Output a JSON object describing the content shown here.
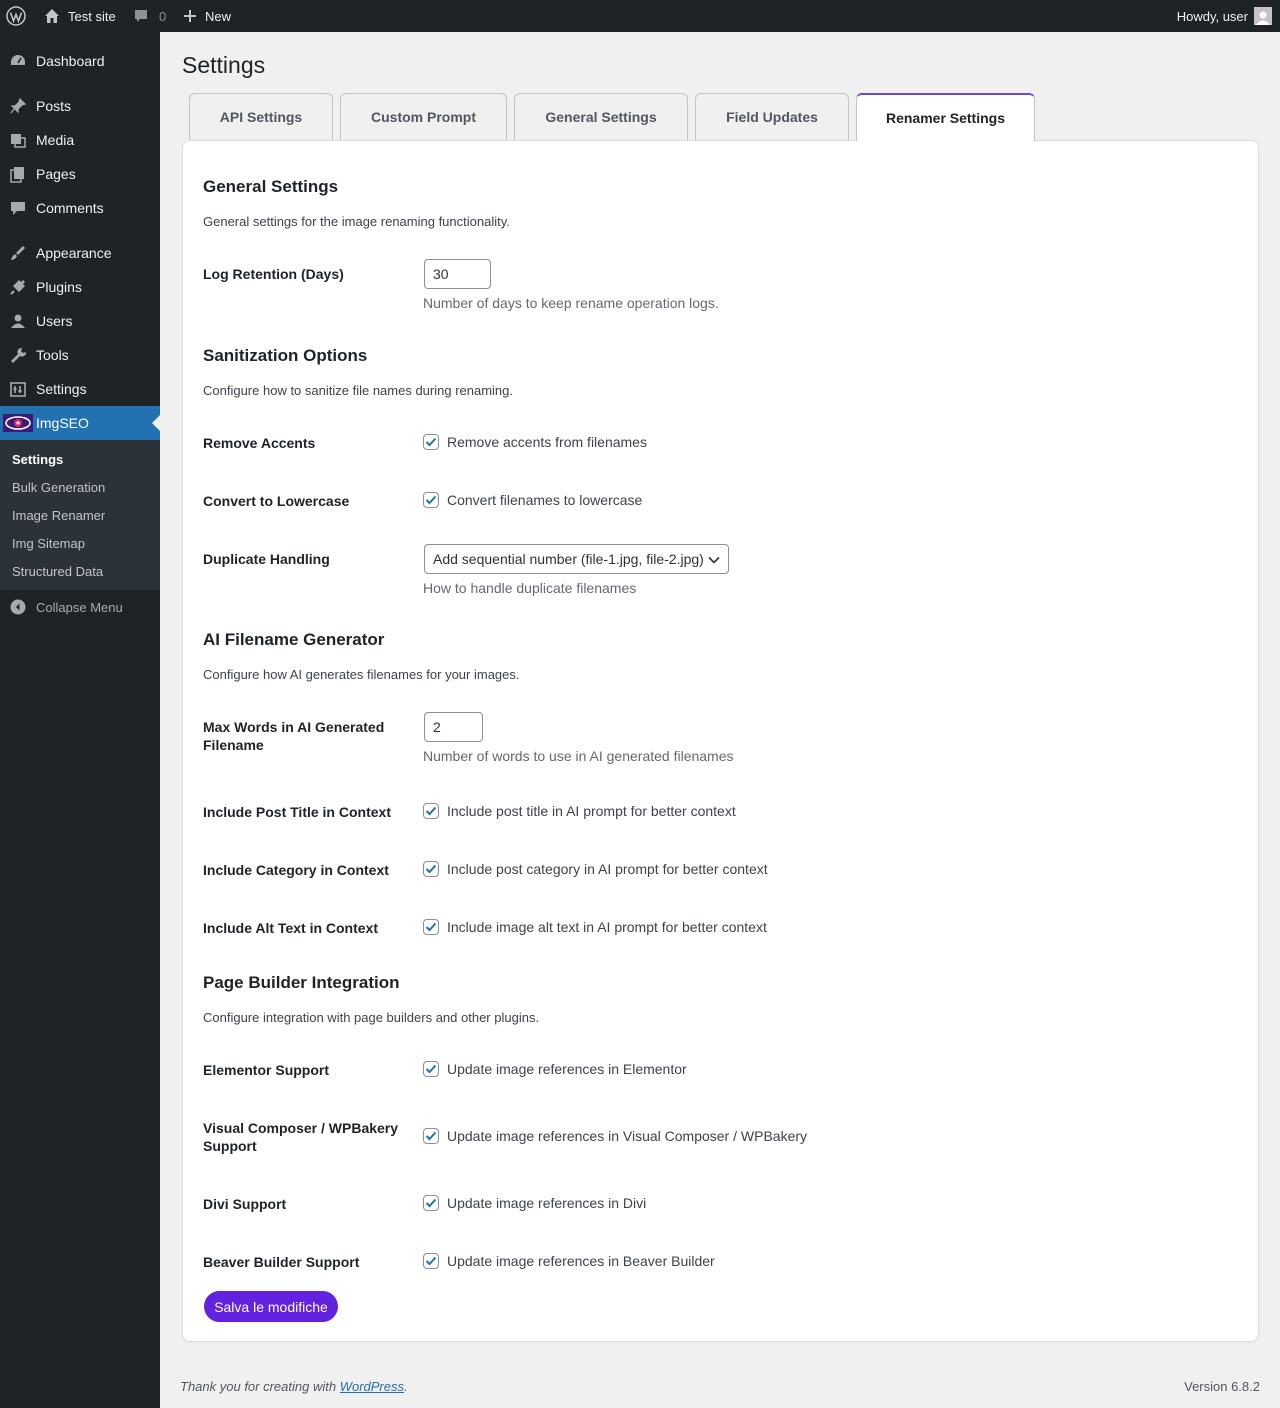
{
  "adminbar": {
    "site_name": "Test site",
    "comments_count": "0",
    "new_label": "New",
    "howdy": "Howdy, user"
  },
  "sidebar": {
    "items": [
      {
        "label": "Dashboard",
        "icon": "dashboard-icon"
      },
      {
        "label": "Posts",
        "icon": "pin-icon"
      },
      {
        "label": "Media",
        "icon": "media-icon"
      },
      {
        "label": "Pages",
        "icon": "pages-icon"
      },
      {
        "label": "Comments",
        "icon": "comments-icon"
      },
      {
        "label": "Appearance",
        "icon": "brush-icon"
      },
      {
        "label": "Plugins",
        "icon": "plugin-icon"
      },
      {
        "label": "Users",
        "icon": "user-icon"
      },
      {
        "label": "Tools",
        "icon": "wrench-icon"
      },
      {
        "label": "Settings",
        "icon": "settings-icon"
      },
      {
        "label": "ImgSEO",
        "icon": "eye-logo-icon"
      }
    ],
    "submenu": [
      "Settings",
      "Bulk Generation",
      "Image Renamer",
      "Img Sitemap",
      "Structured Data"
    ],
    "collapse_label": "Collapse Menu"
  },
  "page": {
    "title": "Settings",
    "tabs": [
      "API Settings",
      "Custom Prompt",
      "General Settings",
      "Field Updates",
      "Renamer Settings"
    ],
    "active_tab": "Renamer Settings"
  },
  "sections": {
    "general": {
      "title": "General Settings",
      "desc": "General settings for the image renaming functionality.",
      "log_retention_label": "Log Retention (Days)",
      "log_retention_value": "30",
      "log_retention_help": "Number of days to keep rename operation logs."
    },
    "sanitization": {
      "title": "Sanitization Options",
      "desc": "Configure how to sanitize file names during renaming.",
      "remove_accents_label": "Remove Accents",
      "remove_accents_text": "Remove accents from filenames",
      "lowercase_label": "Convert to Lowercase",
      "lowercase_text": "Convert filenames to lowercase",
      "duplicate_label": "Duplicate Handling",
      "duplicate_value": "Add sequential number (file-1.jpg, file-2.jpg)",
      "duplicate_help": "How to handle duplicate filenames"
    },
    "ai": {
      "title": "AI Filename Generator",
      "desc": "Configure how AI generates filenames for your images.",
      "max_words_label": "Max Words in AI Generated Filename",
      "max_words_value": "2",
      "max_words_help": "Number of words to use in AI generated filenames",
      "post_title_label": "Include Post Title in Context",
      "post_title_text": "Include post title in AI prompt for better context",
      "category_label": "Include Category in Context",
      "category_text": "Include post category in AI prompt for better context",
      "alt_label": "Include Alt Text in Context",
      "alt_text": "Include image alt text in AI prompt for better context"
    },
    "builder": {
      "title": "Page Builder Integration",
      "desc": "Configure integration with page builders and other plugins.",
      "elementor_label": "Elementor Support",
      "elementor_text": "Update image references in Elementor",
      "vc_label": "Visual Composer / WPBakery Support",
      "vc_text": "Update image references in Visual Composer / WPBakery",
      "divi_label": "Divi Support",
      "divi_text": "Update image references in Divi",
      "beaver_label": "Beaver Builder Support",
      "beaver_text": "Update image references in Beaver Builder"
    }
  },
  "save_button": "Salva le modifiche",
  "footer": {
    "thanks_prefix": "Thank you for creating with ",
    "thanks_link": "WordPress",
    "thanks_suffix": ".",
    "version": "Version 6.8.2"
  },
  "colors": {
    "accent": "#6222e0",
    "admin_bg": "#1d2327",
    "menu_active": "#2271b1",
    "checkbox": "#2271b1"
  }
}
